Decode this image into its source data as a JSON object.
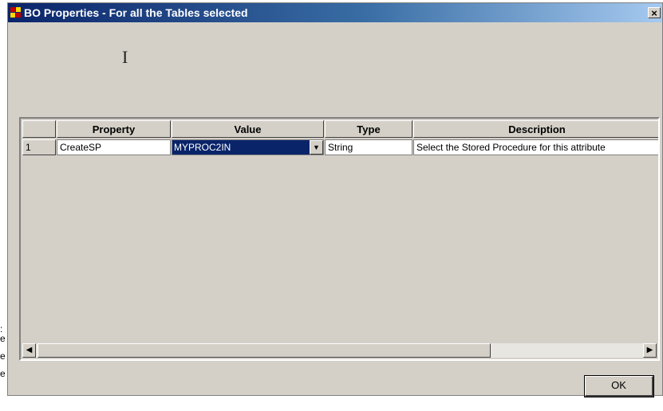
{
  "window": {
    "title": "BO Properties - For all the Tables selected",
    "close_glyph": "×"
  },
  "grid": {
    "columns": [
      "",
      "Property",
      "Value",
      "Type",
      "Description"
    ],
    "rows": [
      {
        "row_number": "1",
        "property": "CreateSP",
        "value": "MYPROC2IN",
        "type": "String",
        "description": "Select the Stored Procedure for this attribute"
      }
    ]
  },
  "buttons": {
    "ok_label": "OK"
  },
  "left_strip_fragments": [
    ":",
    "e",
    "e",
    "e"
  ],
  "icons": {
    "window_icon": "app-icon",
    "close": "close-icon",
    "dropdown": "chevron-down-icon",
    "scroll_left": "arrow-left-icon",
    "scroll_right": "arrow-right-icon",
    "cursor": "ibeam-cursor-icon"
  }
}
